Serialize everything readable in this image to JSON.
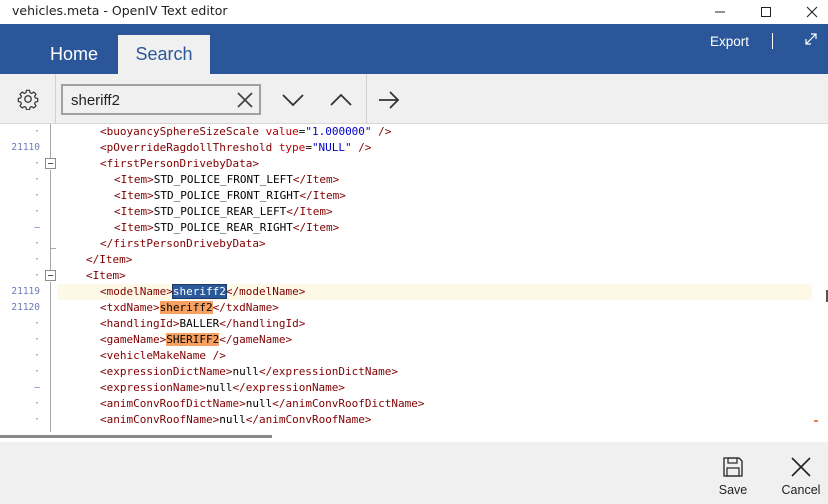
{
  "window": {
    "title": "vehicles.meta - OpenIV Text editor"
  },
  "ribbon": {
    "tabs": [
      {
        "label": "Home"
      },
      {
        "label": "Search"
      }
    ],
    "export_label": "Export",
    "accent_color": "#2b579a"
  },
  "search": {
    "value": "sheriff2",
    "placeholder": ""
  },
  "editor": {
    "line_numbers": [
      "21110",
      "21119",
      "21120"
    ],
    "lines": [
      {
        "indent": "   ",
        "parts": [
          [
            "tag",
            "<buoyancySphereSizeScale "
          ],
          [
            "attr",
            "value"
          ],
          [
            "txt",
            "="
          ],
          [
            "val",
            "\"1.000000\""
          ],
          [
            "tag",
            " />"
          ]
        ]
      },
      {
        "indent": "   ",
        "parts": [
          [
            "tag",
            "<pOverrideRagdollThreshold "
          ],
          [
            "attr",
            "type"
          ],
          [
            "txt",
            "="
          ],
          [
            "val",
            "\"NULL\""
          ],
          [
            "tag",
            " />"
          ]
        ]
      },
      {
        "indent": "   ",
        "parts": [
          [
            "tag",
            "<firstPersonDrivebyData>"
          ]
        ]
      },
      {
        "indent": "     ",
        "parts": [
          [
            "tag",
            "<Item>"
          ],
          [
            "txt",
            "STD_POLICE_FRONT_LEFT"
          ],
          [
            "tag",
            "</Item>"
          ]
        ]
      },
      {
        "indent": "     ",
        "parts": [
          [
            "tag",
            "<Item>"
          ],
          [
            "txt",
            "STD_POLICE_FRONT_RIGHT"
          ],
          [
            "tag",
            "</Item>"
          ]
        ]
      },
      {
        "indent": "     ",
        "parts": [
          [
            "tag",
            "<Item>"
          ],
          [
            "txt",
            "STD_POLICE_REAR_LEFT"
          ],
          [
            "tag",
            "</Item>"
          ]
        ]
      },
      {
        "indent": "     ",
        "parts": [
          [
            "tag",
            "<Item>"
          ],
          [
            "txt",
            "STD_POLICE_REAR_RIGHT"
          ],
          [
            "tag",
            "</Item>"
          ]
        ]
      },
      {
        "indent": "   ",
        "parts": [
          [
            "tag",
            "</firstPersonDrivebyData>"
          ]
        ]
      },
      {
        "indent": " ",
        "parts": [
          [
            "tag",
            "</Item>"
          ]
        ]
      },
      {
        "indent": " ",
        "parts": [
          [
            "tag",
            "<Item>"
          ]
        ]
      },
      {
        "indent": "   ",
        "parts": [
          [
            "tag",
            "<modelName>"
          ],
          [
            "sel",
            "sheriff2"
          ],
          [
            "tag",
            "</modelName>"
          ]
        ]
      },
      {
        "indent": "   ",
        "parts": [
          [
            "tag",
            "<txdName>"
          ],
          [
            "hl",
            "sheriff2"
          ],
          [
            "tag",
            "</txdName>"
          ]
        ]
      },
      {
        "indent": "   ",
        "parts": [
          [
            "tag",
            "<handlingId>"
          ],
          [
            "txt",
            "BALLER"
          ],
          [
            "tag",
            "</handlingId>"
          ]
        ]
      },
      {
        "indent": "   ",
        "parts": [
          [
            "tag",
            "<gameName>"
          ],
          [
            "hl",
            "SHERIFF2"
          ],
          [
            "tag",
            "</gameName>"
          ]
        ]
      },
      {
        "indent": "   ",
        "parts": [
          [
            "tag",
            "<vehicleMakeName />"
          ]
        ]
      },
      {
        "indent": "   ",
        "parts": [
          [
            "tag",
            "<expressionDictName>"
          ],
          [
            "txt",
            "null"
          ],
          [
            "tag",
            "</expressionDictName>"
          ]
        ]
      },
      {
        "indent": "   ",
        "parts": [
          [
            "tag",
            "<expressionName>"
          ],
          [
            "txt",
            "null"
          ],
          [
            "tag",
            "</expressionName>"
          ]
        ]
      },
      {
        "indent": "   ",
        "parts": [
          [
            "tag",
            "<animConvRoofDictName>"
          ],
          [
            "txt",
            "null"
          ],
          [
            "tag",
            "</animConvRoofDictName>"
          ]
        ]
      },
      {
        "indent": "   ",
        "parts": [
          [
            "tag",
            "<animConvRoofName>"
          ],
          [
            "txt",
            "null"
          ],
          [
            "tag",
            "</animConvRoofName>"
          ]
        ]
      }
    ],
    "highlight_color": "#f7a060",
    "selection_color": "#2a5a9a"
  },
  "footer": {
    "save_label": "Save",
    "cancel_label": "Cancel"
  }
}
